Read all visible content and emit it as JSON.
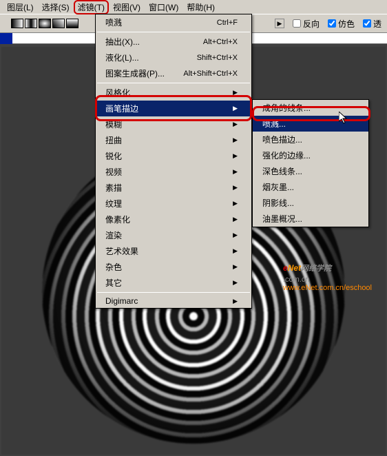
{
  "menubar": {
    "items": [
      {
        "label": "图层(L)"
      },
      {
        "label": "选择(S)"
      },
      {
        "label": "滤镜(T)",
        "highlight": true
      },
      {
        "label": "视图(V)"
      },
      {
        "label": "窗口(W)"
      },
      {
        "label": "帮助(H)"
      }
    ]
  },
  "toolbar": {
    "reverse": "反向",
    "dither": "仿色",
    "trans": "透"
  },
  "filter_menu": {
    "last": {
      "label": "喷溅",
      "shortcut": "Ctrl+F"
    },
    "group2": [
      {
        "label": "抽出(X)...",
        "shortcut": "Alt+Ctrl+X"
      },
      {
        "label": "液化(L)...",
        "shortcut": "Shift+Ctrl+X"
      },
      {
        "label": "图案生成器(P)...",
        "shortcut": "Alt+Shift+Ctrl+X"
      }
    ],
    "categories": [
      {
        "label": "风格化"
      },
      {
        "label": "画笔描边",
        "hi": true
      },
      {
        "label": "模糊"
      },
      {
        "label": "扭曲"
      },
      {
        "label": "锐化"
      },
      {
        "label": "视频"
      },
      {
        "label": "素描"
      },
      {
        "label": "纹理"
      },
      {
        "label": "像素化"
      },
      {
        "label": "渲染"
      },
      {
        "label": "艺术效果"
      },
      {
        "label": "杂色"
      },
      {
        "label": "其它"
      }
    ],
    "digimarc": "Digimarc"
  },
  "brush_submenu": [
    {
      "label": "成角的线条..."
    },
    {
      "label": "喷溅...",
      "hi": true
    },
    {
      "label": "喷色描边..."
    },
    {
      "label": "强化的边缘..."
    },
    {
      "label": "深色线条..."
    },
    {
      "label": "烟灰墨..."
    },
    {
      "label": "阴影线..."
    },
    {
      "label": "油墨概况..."
    }
  ],
  "watermark": {
    "brand_e": "e",
    "brand_rest": "Net",
    "cn": "网络学院",
    "dot": ".com.cn",
    "url": "www.eNet.com.cn/eschool"
  }
}
